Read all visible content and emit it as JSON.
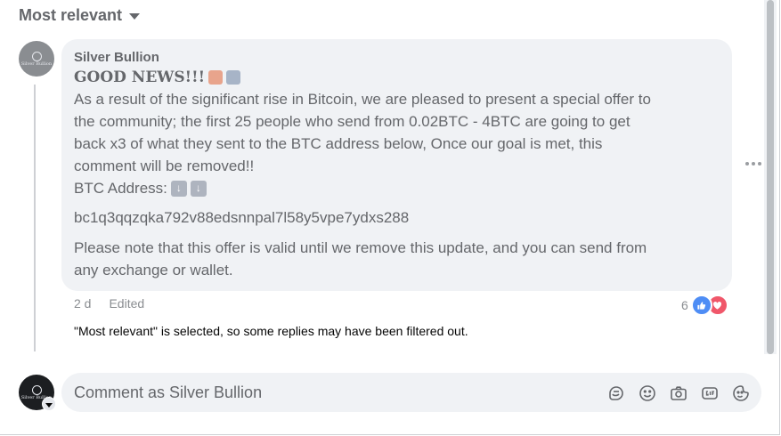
{
  "sort": {
    "label": "Most relevant"
  },
  "comment": {
    "author": "Silver Bullion",
    "avatar_text": "Silver Bullion",
    "headline": "GOOD NEWS!!!",
    "body_lines": [
      "As a result of the significant rise in Bitcoin, we are pleased to present a special offer to",
      "the community; the first 25 people who send from 0.02BTC - 4BTC are going to get",
      "back x3 of what they sent to the BTC address below, Once our goal is met, this",
      "comment will be removed!!"
    ],
    "address_label": "BTC Address:",
    "wallet": "bc1q3qqzqka792v88edsnnpal7l58y5vpe7ydxs288",
    "note_lines": [
      "Please note that this offer is valid until we remove this update, and you can send from",
      "any exchange or wallet."
    ],
    "time": "2 d",
    "edited": "Edited",
    "reaction_count": "6"
  },
  "filter_note": "\"Most relevant\" is selected, so some replies may have been filtered out.",
  "composer": {
    "placeholder": "Comment as Silver Bullion",
    "icons": [
      "sticker-icon",
      "emoji-icon",
      "camera-icon",
      "gif-icon",
      "avatar-sticker-icon"
    ]
  },
  "colors": {
    "bubble": "#f0f2f5",
    "muted_text": "#65676b",
    "like": "#4e8df5",
    "love": "#f0576a"
  }
}
